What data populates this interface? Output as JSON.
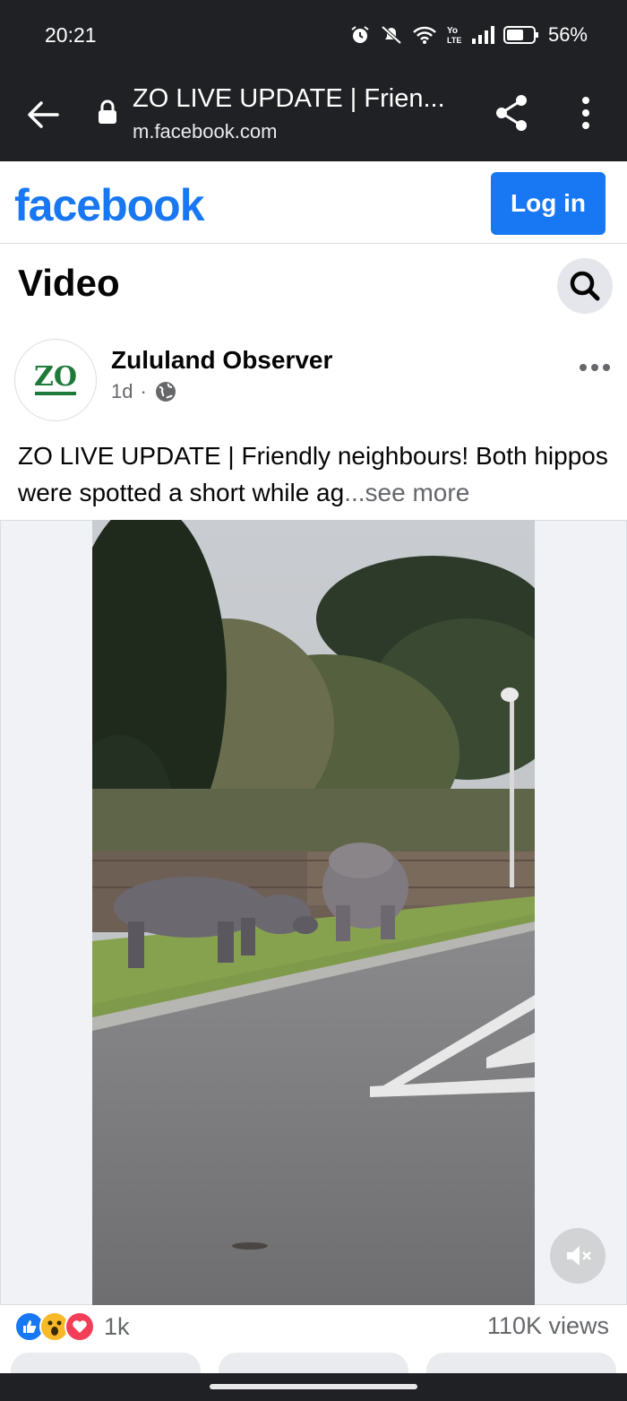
{
  "status_bar": {
    "time": "20:21",
    "battery": "56%",
    "icons": [
      "alarm-icon",
      "mute-icon",
      "wifi-icon",
      "volte-icon",
      "signal-icon",
      "battery-icon"
    ]
  },
  "browser": {
    "page_title": "ZO LIVE UPDATE | Frien...",
    "domain": "m.facebook.com"
  },
  "header": {
    "logo": "facebook",
    "login_label": "Log in",
    "brand_color": "#1877f2"
  },
  "page": {
    "title": "Video"
  },
  "post": {
    "author": "Zululand Observer",
    "avatar_text": "ZO",
    "time": "1d",
    "separator": "·",
    "text": "ZO LIVE UPDATE | Friendly neighbours! Both hippos were spotted a short while ag",
    "see_more": "...see more"
  },
  "stats": {
    "reaction_count": "1k",
    "views": "110K views",
    "reactions": [
      "like",
      "wow",
      "love"
    ]
  }
}
